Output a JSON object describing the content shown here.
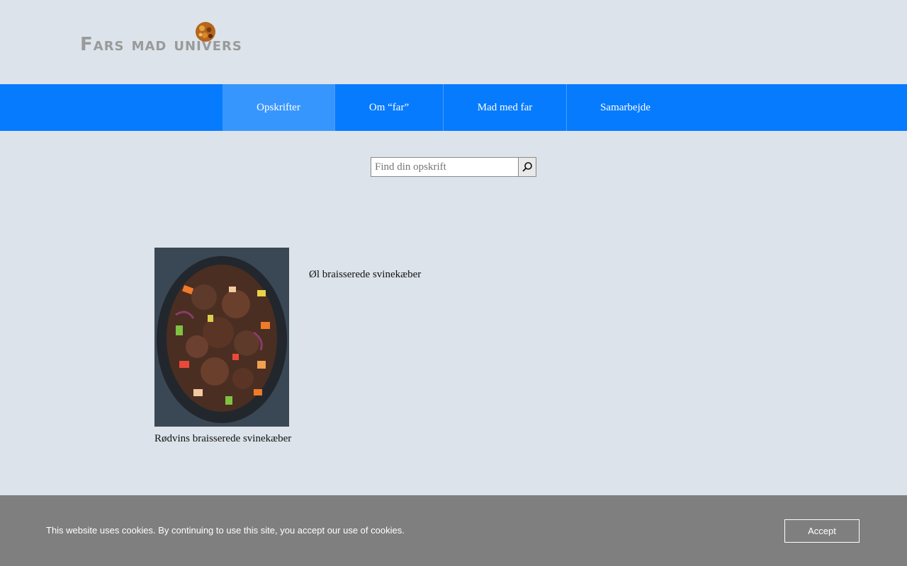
{
  "header": {
    "logo_text": "Fars mad univers"
  },
  "nav": {
    "items": [
      {
        "label": "Opskrifter",
        "active": true
      },
      {
        "label": "Om “far”",
        "active": false
      },
      {
        "label": "Mad med far",
        "active": false
      },
      {
        "label": "Samarbejde",
        "active": false
      }
    ]
  },
  "search": {
    "placeholder": "Find din opskrift",
    "value": "",
    "button_icon": "search-icon"
  },
  "recipes": [
    {
      "title": "Rødvins braisserede svinekæber",
      "has_image": true
    },
    {
      "title": "Øl braisserede svinekæber",
      "has_image": false
    }
  ],
  "cookie_banner": {
    "text": "This website uses cookies. By continuing to use this site, you accept our use of cookies.",
    "accept_label": "Accept"
  },
  "colors": {
    "background": "#dce3ea",
    "nav": "#067bfe",
    "nav_active": "#3796fe",
    "cookie_banner": "#7f7f7f"
  }
}
